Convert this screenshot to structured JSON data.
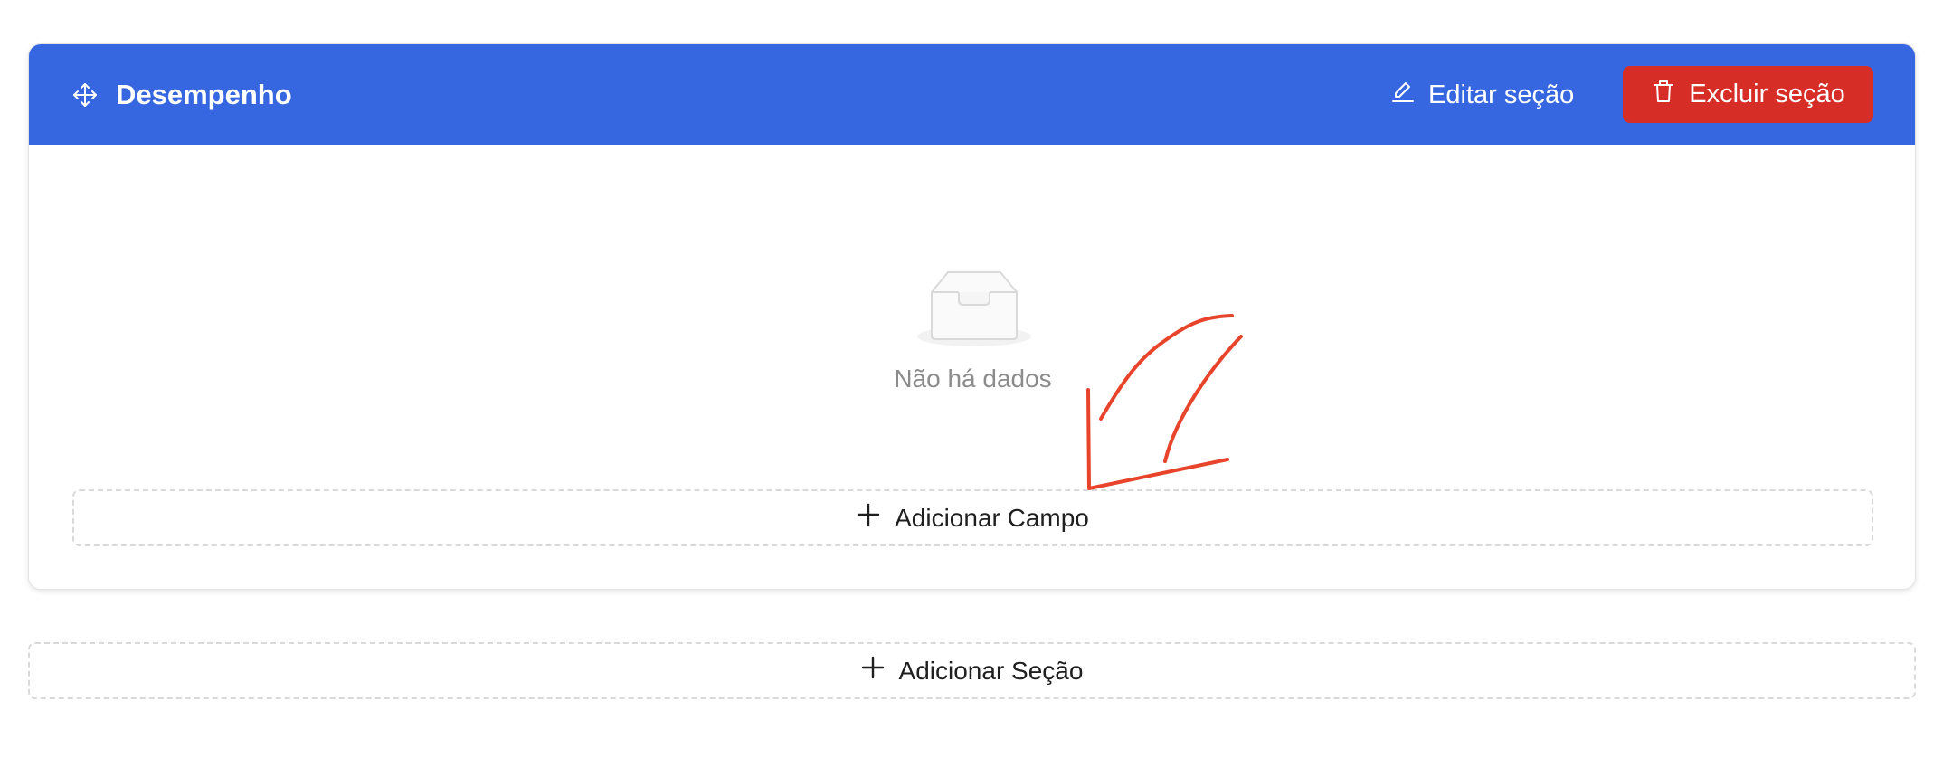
{
  "section": {
    "title": "Desempenho",
    "edit_label": "Editar seção",
    "delete_label": "Excluir seção",
    "empty_text": "Não há dados",
    "add_field_label": "Adicionar Campo"
  },
  "add_section_label": "Adicionar Seção",
  "colors": {
    "header_bg": "#3767e0",
    "delete_bg": "#d62d27",
    "annotation_stroke": "#e8442b"
  },
  "icons": {
    "drag": "move-icon",
    "edit": "pencil-icon",
    "delete": "trash-icon",
    "empty": "inbox-icon",
    "add": "plus-icon"
  }
}
